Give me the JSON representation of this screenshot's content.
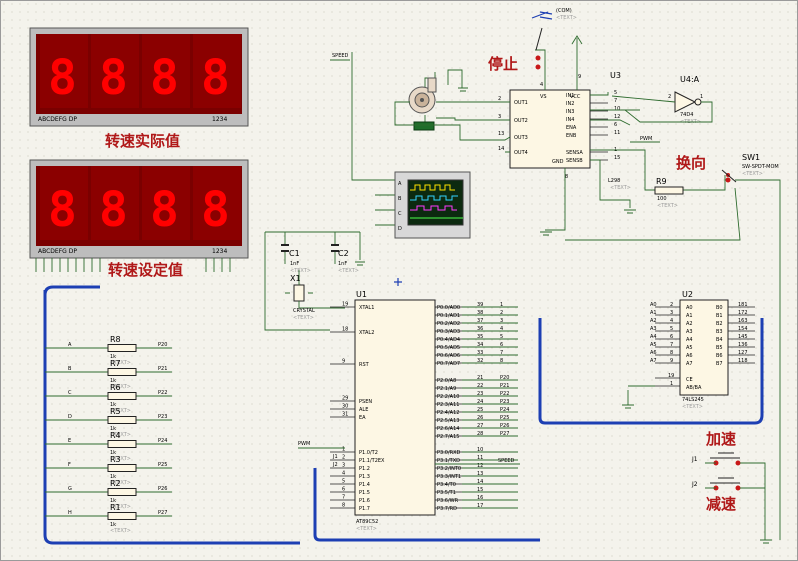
{
  "displays": {
    "actual": {
      "segments_label": "ABCDEFG  DP",
      "digits_label": "1234",
      "title": "转速实际值",
      "digits": [
        "8",
        "8",
        "8",
        "8"
      ]
    },
    "set": {
      "segments_label": "ABCDEFG  DP",
      "digits_label": "1234",
      "title": "转速设定值",
      "digits": [
        "8",
        "8",
        "8",
        "8"
      ]
    }
  },
  "labels": {
    "stop": "停止",
    "reverse": "换向",
    "accel": "加速",
    "decel": "减速",
    "speed": "SPEED",
    "speed2": "SPEED",
    "pwm": "PWM",
    "pwm2": "PWM",
    "com": "(COM)",
    "text_hint": "<TEXT>"
  },
  "u3": {
    "ref": "U3",
    "left_pins": [
      "OUT1",
      "OUT2",
      "OUT3",
      "OUT4"
    ],
    "left_nums": [
      "2",
      "3",
      "13",
      "14"
    ],
    "top": [
      "VS",
      "VCC"
    ],
    "right_pins": [
      "IN1",
      "IN2",
      "IN3",
      "IN4",
      "ENA",
      "ENB",
      "SENSA",
      "SENSB"
    ],
    "right_nums": [
      "5",
      "7",
      "10",
      "12",
      "6",
      "11",
      "1",
      "15"
    ],
    "gnd": "GND",
    "gnd_num": "8",
    "vcc_num": "9",
    "vs_num": "4",
    "name": "L298"
  },
  "u4": {
    "ref": "U4:A",
    "name": "74D4",
    "p1": "1",
    "p2": "2"
  },
  "r9": {
    "ref": "R9",
    "value": "100"
  },
  "sw1": {
    "ref": "SW1",
    "name": "SW-SPDT-MOM"
  },
  "osc": {
    "pins": [
      "A",
      "B",
      "C",
      "D"
    ]
  },
  "crystal": {
    "c1": "C1",
    "c1v": "1nF",
    "c2": "C2",
    "c2v": "1nF",
    "x1": "X1",
    "xname": "CRYSTAL"
  },
  "u1": {
    "ref": "U1",
    "name": "AT89C52",
    "left": [
      {
        "n": "19",
        "t": "XTAL1"
      },
      {
        "n": "18",
        "t": "XTAL2"
      },
      {
        "n": "9",
        "t": "RST"
      },
      {
        "n": "29",
        "t": "PSEN"
      },
      {
        "n": "30",
        "t": "ALE"
      },
      {
        "n": "31",
        "t": "EA"
      },
      {
        "n": "1",
        "t": "P1.0/T2"
      },
      {
        "n": "2",
        "t": "P1.1/T2EX"
      },
      {
        "n": "3",
        "t": "P1.2"
      },
      {
        "n": "4",
        "t": "P1.3"
      },
      {
        "n": "5",
        "t": "P1.4"
      },
      {
        "n": "6",
        "t": "P1.5"
      },
      {
        "n": "7",
        "t": "P1.6"
      },
      {
        "n": "8",
        "t": "P1.7"
      }
    ],
    "p0": [
      "P0.0/AD0",
      "P0.1/AD1",
      "P0.2/AD2",
      "P0.3/AD3",
      "P0.4/AD4",
      "P0.5/AD5",
      "P0.6/AD6",
      "P0.7/AD7"
    ],
    "p0n": [
      "39",
      "38",
      "37",
      "36",
      "35",
      "34",
      "33",
      "32"
    ],
    "p2": [
      "P2.0/A8",
      "P2.1/A9",
      "P2.2/A10",
      "P2.3/A11",
      "P2.4/A12",
      "P2.5/A13",
      "P2.6/A14",
      "P2.7/A15"
    ],
    "p2n": [
      "21",
      "22",
      "23",
      "24",
      "25",
      "26",
      "27",
      "28"
    ],
    "p2net": [
      "P20",
      "P21",
      "P22",
      "P23",
      "P24",
      "P25",
      "P26",
      "P27"
    ],
    "p3": [
      "P3.0/RXD",
      "P3.1/TXD",
      "P3.2/INT0",
      "P3.3/INT1",
      "P3.4/T0",
      "P3.5/T1",
      "P3.6/WR",
      "P3.7/RD"
    ],
    "p3n": [
      "10",
      "11",
      "12",
      "13",
      "14",
      "15",
      "16",
      "17"
    ],
    "p1net": [
      "PWM",
      "J1",
      "J2"
    ]
  },
  "u2": {
    "ref": "U2",
    "name": "74LS245",
    "a": [
      "A0",
      "A1",
      "A2",
      "A3",
      "A4",
      "A5",
      "A6",
      "A7"
    ],
    "b": [
      "B0",
      "B1",
      "B2",
      "B3",
      "B4",
      "B5",
      "B6",
      "B7"
    ],
    "an": [
      "2",
      "3",
      "4",
      "5",
      "6",
      "7",
      "8",
      "9"
    ],
    "bn": [
      "18",
      "17",
      "16",
      "15",
      "14",
      "13",
      "12",
      "11"
    ],
    "bnet": [
      "181",
      "172",
      "163",
      "154",
      "145",
      "136",
      "127",
      "118"
    ],
    "anet": [
      "A0",
      "A1",
      "A2",
      "A3",
      "A4",
      "A5",
      "A6",
      "A7"
    ],
    "ce": "CE",
    "ab": "AB/BA",
    "cen": "19",
    "abn": "1"
  },
  "resistors": [
    {
      "ref": "R8",
      "v": "1k",
      "in": "A",
      "out": "P20"
    },
    {
      "ref": "R7",
      "v": "1k",
      "in": "B",
      "out": "P21"
    },
    {
      "ref": "R6",
      "v": "1k",
      "in": "C",
      "out": "P22"
    },
    {
      "ref": "R5",
      "v": "1k",
      "in": "D",
      "out": "P23"
    },
    {
      "ref": "R4",
      "v": "1k",
      "in": "E",
      "out": "P24"
    },
    {
      "ref": "R3",
      "v": "1k",
      "in": "F",
      "out": "P25"
    },
    {
      "ref": "R2",
      "v": "1k",
      "in": "G",
      "out": "P26"
    },
    {
      "ref": "R1",
      "v": "1k",
      "in": "H",
      "out": "P27"
    }
  ],
  "buttons": {
    "j1": "J1",
    "j2": "J2"
  }
}
